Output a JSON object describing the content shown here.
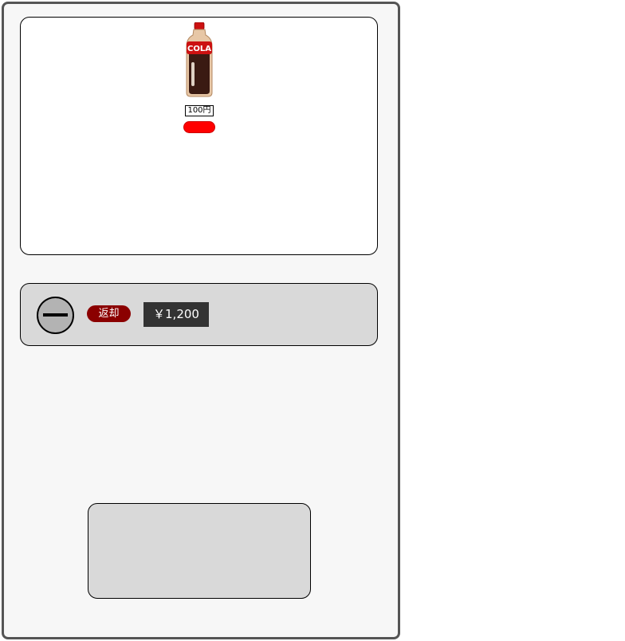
{
  "products": [
    {
      "name": "COLA",
      "price": "100円",
      "button_color": "#ff0000",
      "label_color": "#cc1111",
      "liquid_color": "#3a1a12"
    }
  ],
  "controls": {
    "coin_slot_icon": "minus-circle-icon",
    "return_label": "返却",
    "balance": "￥1,200"
  },
  "colors": {
    "machine_border": "#555555",
    "machine_bg": "#f7f7f7",
    "panel_bg": "#d9d9d9",
    "return_bg": "#8b0000",
    "balance_bg": "#333333"
  }
}
